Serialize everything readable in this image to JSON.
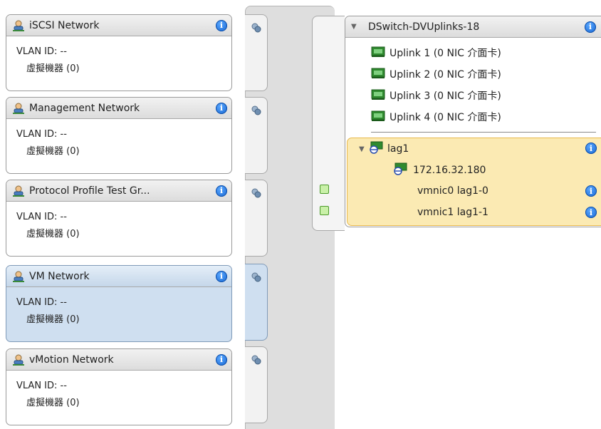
{
  "port_groups": [
    {
      "name": "iSCSI Network",
      "vlan": "VLAN ID: --",
      "vms": "虛擬機器 (0)",
      "selected": false
    },
    {
      "name": "Management Network",
      "vlan": "VLAN ID: --",
      "vms": "虛擬機器 (0)",
      "selected": false
    },
    {
      "name": "Protocol Profile Test Gr...",
      "vlan": "VLAN ID: --",
      "vms": "虛擬機器 (0)",
      "selected": false
    },
    {
      "name": "VM Network",
      "vlan": "VLAN ID: --",
      "vms": "虛擬機器 (0)",
      "selected": true
    },
    {
      "name": "vMotion Network",
      "vlan": "VLAN ID: --",
      "vms": "虛擬機器 (0)",
      "selected": false
    }
  ],
  "uplink_group": {
    "title": "DSwitch-DVUplinks-18",
    "uplinks": [
      "Uplink 1 (0 NIC 介面卡)",
      "Uplink 2 (0 NIC 介面卡)",
      "Uplink 3 (0 NIC 介面卡)",
      "Uplink 4 (0 NIC 介面卡)"
    ],
    "lag": {
      "name": "lag1",
      "host": "172.16.32.180",
      "ports": [
        "vmnic0 lag1-0",
        "vmnic1 lag1-1"
      ]
    }
  },
  "colors": {
    "accent_orange": "#f39a1e",
    "selected_bg": "#cfdff0",
    "lag_bg": "#fbeab3",
    "info_blue": "#1463d0"
  },
  "icons": {
    "port_group": "network-user-icon",
    "info": "info-icon",
    "uplink": "nic-card-icon",
    "lag": "lag-icon",
    "host": "host-icon",
    "port": "port-connector-icon"
  }
}
